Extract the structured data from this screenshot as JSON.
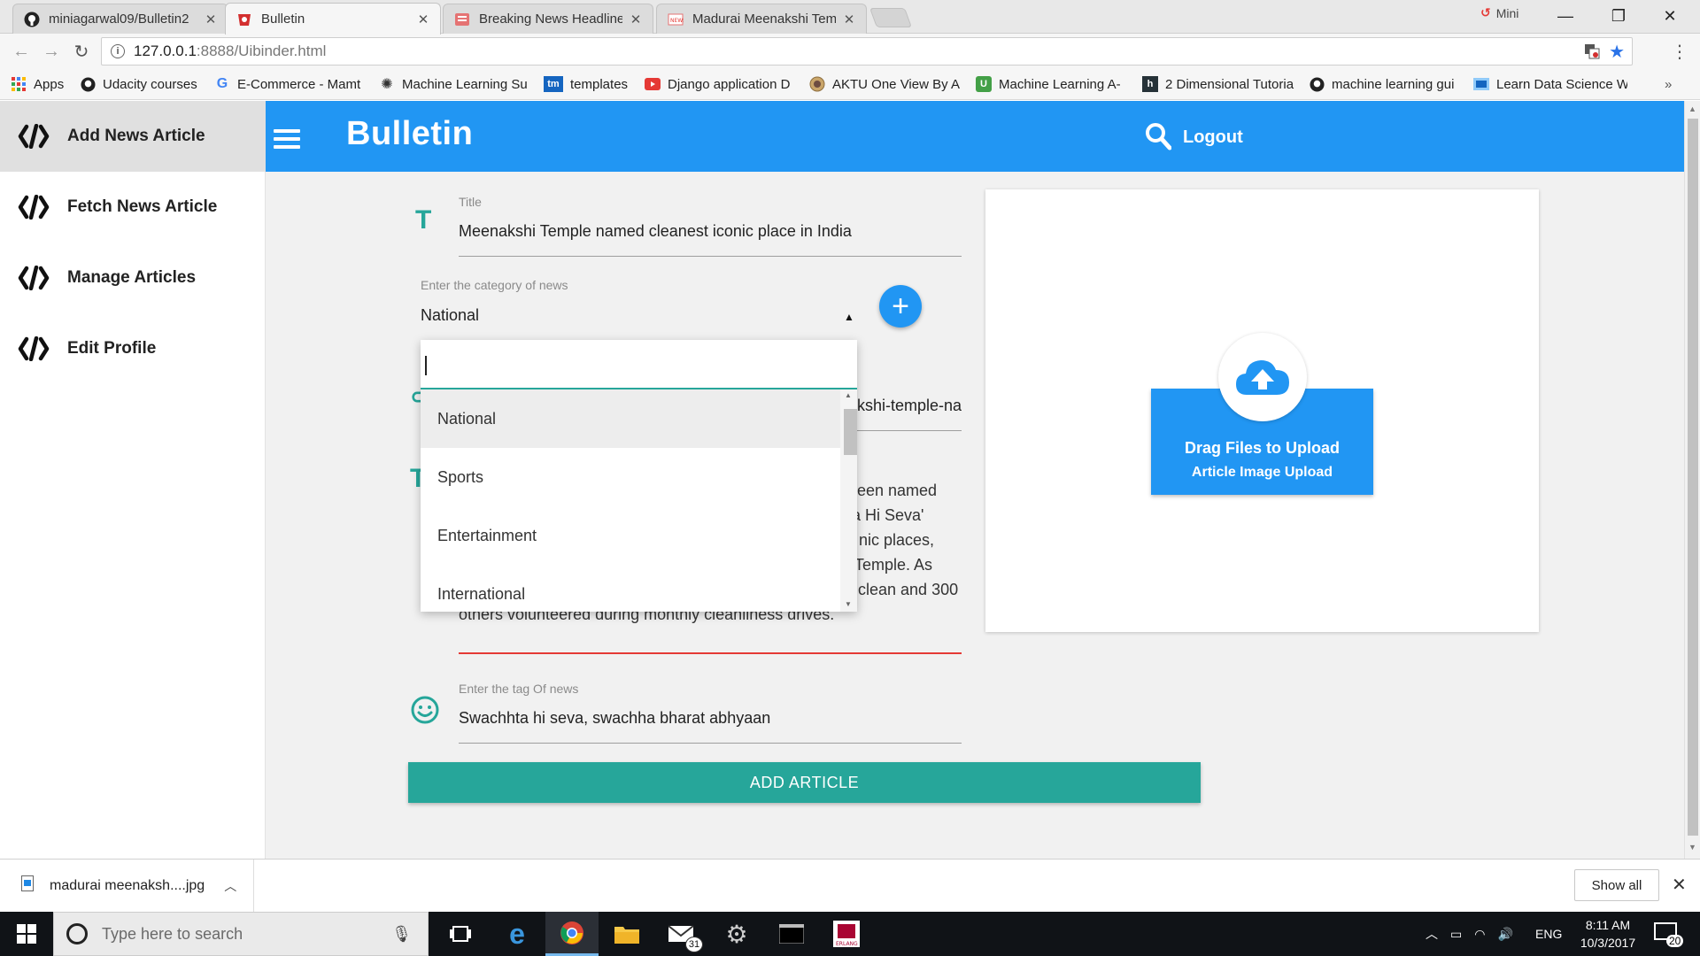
{
  "browser": {
    "tabs": [
      {
        "title": "miniagarwal09/Bulletin2",
        "icon": "github-icon"
      },
      {
        "title": "Bulletin",
        "icon": "bulletin-favicon"
      },
      {
        "title": "Breaking News Headlines",
        "icon": "news-favicon"
      },
      {
        "title": "Madurai Meenakshi Temple",
        "icon": "news-favicon"
      }
    ],
    "profile_name": "Mini",
    "url_host": "127.0.0.1",
    "url_rest": ":8888/Uibinder.html",
    "bookmarks": [
      {
        "label": "Apps",
        "icon": "apps-icon"
      },
      {
        "label": "Udacity courses",
        "icon": "github-icon"
      },
      {
        "label": "E-Commerce - Mamt",
        "icon": "google-icon"
      },
      {
        "label": "Machine Learning Su",
        "icon": "atom-icon"
      },
      {
        "label": "templates",
        "icon": "tm-icon"
      },
      {
        "label": "Django application D",
        "icon": "youtube-icon"
      },
      {
        "label": "AKTU One View By Al",
        "icon": "seal-icon"
      },
      {
        "label": "Machine Learning A-",
        "icon": "udemy-icon"
      },
      {
        "label": "2 Dimensional Tutoria",
        "icon": "h-icon"
      },
      {
        "label": "machine learning gui",
        "icon": "github-icon"
      },
      {
        "label": "Learn Data Science W",
        "icon": "datascience-icon"
      }
    ]
  },
  "sidebar": {
    "items": [
      {
        "label": "Add News Article"
      },
      {
        "label": "Fetch News Article"
      },
      {
        "label": "Manage Articles"
      },
      {
        "label": "Edit Profile"
      }
    ]
  },
  "appbar": {
    "brand": "Bulletin",
    "logout": "Logout"
  },
  "form": {
    "title_label": "Title",
    "title_value": "Meenakshi Temple named cleanest iconic place in India",
    "category_label": "Enter the category of news",
    "category_value": "National",
    "url_partial": "kshi-temple-na",
    "content_lines": [
      "een named",
      "a Hi Seva'",
      "nic places,",
      "Temple. As",
      "clean and 300",
      "others volunteered during monthly cleanliness drives."
    ],
    "tag_label": "Enter the tag Of news",
    "tag_value": "Swachhta hi seva, swachha bharat abhyaan",
    "submit_label": "ADD ARTICLE"
  },
  "dropdown": {
    "options": [
      "National",
      "Sports",
      "Entertainment",
      "International"
    ],
    "selected": "National"
  },
  "upload": {
    "title": "Drag Files to Upload",
    "subtitle": "Article Image Upload"
  },
  "downloads": {
    "file": "madurai meenaksh....jpg",
    "show_all": "Show all"
  },
  "taskbar": {
    "search_placeholder": "Type here to search",
    "mail_badge": "31",
    "language": "ENG",
    "time": "8:11 AM",
    "date": "10/3/2017",
    "notification_count": "20"
  }
}
